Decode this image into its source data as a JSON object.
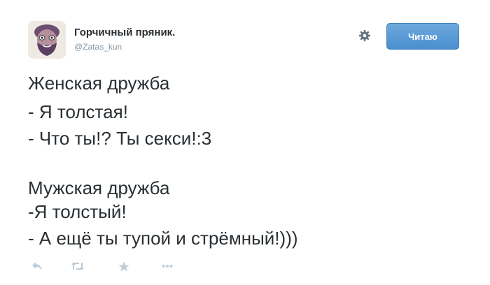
{
  "user": {
    "name": "Горчичный пряник.",
    "handle": "@Zatas_kun"
  },
  "follow_button": {
    "label": "Читаю"
  },
  "tweet_lines": [
    "Женская дружба",
    "- Я толстая!",
    "- Что ты!? Ты секси!:3",
    "Мужская дружба",
    "-Я толстый!",
    "- А ещё ты тупой и стрёмный!)))"
  ],
  "icons": {
    "avatar": "bearded-cartoon-avatar",
    "settings": "gear-icon",
    "reply": "reply-icon",
    "retweet": "retweet-icon",
    "favorite": "star-icon",
    "more": "more-icon"
  },
  "colors": {
    "text": "#292f33",
    "muted": "#8899a6",
    "button": "#4a8fd0",
    "action_icon": "#c0ccd6"
  }
}
